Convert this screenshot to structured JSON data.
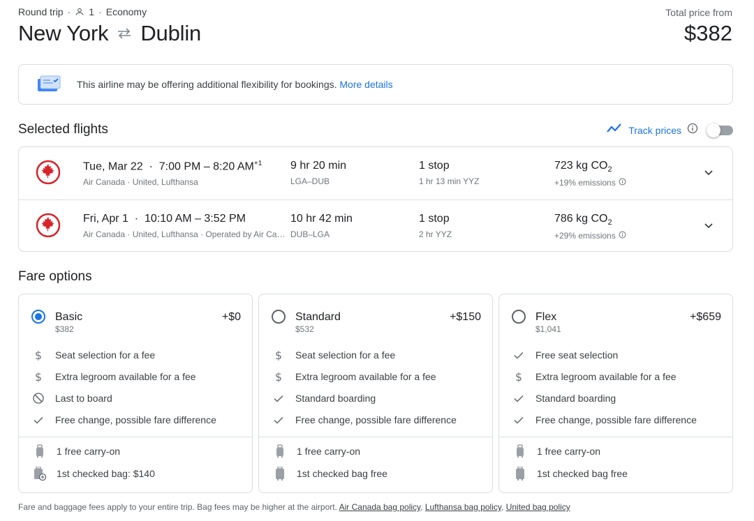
{
  "header": {
    "trip_type": "Round trip",
    "passengers": "1",
    "cabin": "Economy",
    "origin": "New York",
    "destination": "Dublin",
    "price_label": "Total price from",
    "price": "$382"
  },
  "banner": {
    "text": "This airline may be offering additional flexibility for bookings.",
    "link": "More details"
  },
  "selected_flights": {
    "title": "Selected flights",
    "track_prices_label": "Track prices",
    "flights": [
      {
        "date": "Tue, Mar 22",
        "times": "7:00 PM – 8:20 AM",
        "day_offset": "+1",
        "airlines": "Air Canada · United, Lufthansa",
        "duration": "9 hr 20 min",
        "route": "LGA–DUB",
        "stops": "1 stop",
        "layover": "1 hr 13 min YYZ",
        "emissions_value": "723 kg CO",
        "emissions_sub": "2",
        "emissions_diff": "+19% emissions"
      },
      {
        "date": "Fri, Apr 1",
        "times": "10:10 AM – 3:52 PM",
        "day_offset": "",
        "airlines": "Air Canada · United, Lufthansa · Operated by Air Canada",
        "duration": "10 hr 42 min",
        "route": "DUB–LGA",
        "stops": "1 stop",
        "layover": "2 hr YYZ",
        "emissions_value": "786 kg CO",
        "emissions_sub": "2",
        "emissions_diff": "+29% emissions"
      }
    ]
  },
  "fare_options": {
    "title": "Fare options",
    "fares": [
      {
        "name": "Basic",
        "price": "$382",
        "add": "+$0",
        "selected": true,
        "features": [
          {
            "icon": "dollar-icon",
            "text": "Seat selection for a fee"
          },
          {
            "icon": "dollar-icon",
            "text": "Extra legroom available for a fee"
          },
          {
            "icon": "block-icon",
            "text": "Last to board"
          },
          {
            "icon": "check-icon",
            "text": "Free change, possible fare difference"
          }
        ],
        "bags": [
          {
            "icon": "carry-on-icon",
            "text": "1 free carry-on"
          },
          {
            "icon": "checked-bag-fee-icon",
            "text": "1st checked bag: $140"
          }
        ]
      },
      {
        "name": "Standard",
        "price": "$532",
        "add": "+$150",
        "selected": false,
        "features": [
          {
            "icon": "dollar-icon",
            "text": "Seat selection for a fee"
          },
          {
            "icon": "dollar-icon",
            "text": "Extra legroom available for a fee"
          },
          {
            "icon": "check-icon",
            "text": "Standard boarding"
          },
          {
            "icon": "check-icon",
            "text": "Free change, possible fare difference"
          }
        ],
        "bags": [
          {
            "icon": "carry-on-icon",
            "text": "1 free carry-on"
          },
          {
            "icon": "checked-bag-icon",
            "text": "1st checked bag free"
          }
        ]
      },
      {
        "name": "Flex",
        "price": "$1,041",
        "add": "+$659",
        "selected": false,
        "features": [
          {
            "icon": "check-icon",
            "text": "Free seat selection"
          },
          {
            "icon": "dollar-icon",
            "text": "Extra legroom available for a fee"
          },
          {
            "icon": "check-icon",
            "text": "Standard boarding"
          },
          {
            "icon": "check-icon",
            "text": "Free change, possible fare difference"
          }
        ],
        "bags": [
          {
            "icon": "carry-on-icon",
            "text": "1 free carry-on"
          },
          {
            "icon": "checked-bag-icon",
            "text": "1st checked bag free"
          }
        ]
      }
    ]
  },
  "footer": {
    "text": "Fare and baggage fees apply to your entire trip. Bag fees may be higher at the airport.",
    "links": [
      "Air Canada bag policy",
      "Lufthansa bag policy",
      "United bag policy"
    ]
  },
  "colors": {
    "accent": "#1a73e8",
    "air_canada_red": "#d8232a",
    "border": "#dadce0"
  }
}
